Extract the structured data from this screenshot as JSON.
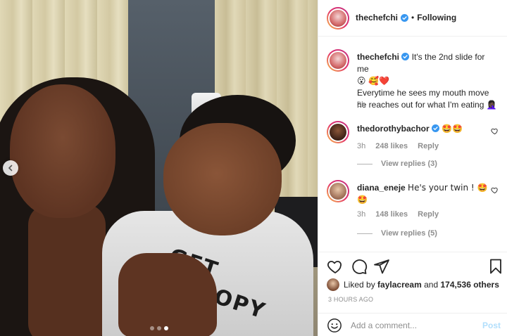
{
  "post": {
    "carousel": {
      "slide_count": 3,
      "active_index": 2
    }
  },
  "header": {
    "username": "thechefchi",
    "separator": "•",
    "follow_status": "Following"
  },
  "caption": {
    "username": "thechefchi",
    "text_line1": "It's the 2nd slide for me",
    "emojis_line1": "😮 🥰❤️",
    "text_line2": "Everytime he sees my mouth move he reaches out for what I'm eating",
    "emoji_line2": "🤦🏿‍♀️",
    "time": "3h"
  },
  "comments": [
    {
      "username": "thedorothybachor",
      "text": "🤩🤩",
      "time": "3h",
      "likes": "248 likes",
      "reply": "Reply",
      "view_replies": "View replies (3)"
    },
    {
      "username": "diana_eneje",
      "text": "He's your twin ! 🤩",
      "text_extra": "🤩",
      "time": "3h",
      "likes": "148 likes",
      "reply": "Reply",
      "view_replies": "View replies (5)"
    }
  ],
  "actions": {
    "liked_by_prefix": "Liked by",
    "liked_by_user": "faylacream",
    "liked_by_and": "and",
    "liked_by_count": "174,536 others",
    "timestamp": "3 HOURS AGO"
  },
  "add_comment": {
    "placeholder": "Add a comment...",
    "post_label": "Post"
  },
  "colors": {
    "verified": "#3897f0",
    "post_disabled": "#b2dffc",
    "meta": "#8e8e8e"
  },
  "photo": {
    "shirt_text": "GET SNOOPY"
  }
}
